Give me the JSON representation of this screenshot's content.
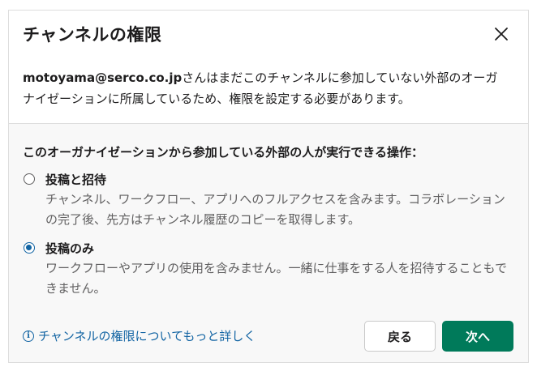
{
  "dialog": {
    "title": "チャンネルの権限",
    "intro_email": "motoyama@serco.co.jp",
    "intro_text": "さんはまだこのチャンネルに参加していない外部のオーガナイゼーションに所属しているため、権限を設定する必要があります。",
    "section_label": "このオーガナイゼーションから参加している外部の人が実行できる操作：",
    "options": [
      {
        "title": "投稿と招待",
        "description": "チャンネル、ワークフロー、アプリへのフルアクセスを含みます。コラボレーションの完了後、先方はチャンネル履歴のコピーを取得します。",
        "selected": false
      },
      {
        "title": "投稿のみ",
        "description": "ワークフローやアプリの使用を含みません。一緒に仕事をする人を招待することもできません。",
        "selected": true
      }
    ],
    "help_link": "チャンネルの権限についてもっと詳しく",
    "back_label": "戻る",
    "next_label": "次へ"
  },
  "icons": {
    "close": "close-icon",
    "info": "info-icon"
  },
  "colors": {
    "accent": "#1264a3",
    "primary_button": "#007a5a",
    "muted_text": "#616061"
  }
}
